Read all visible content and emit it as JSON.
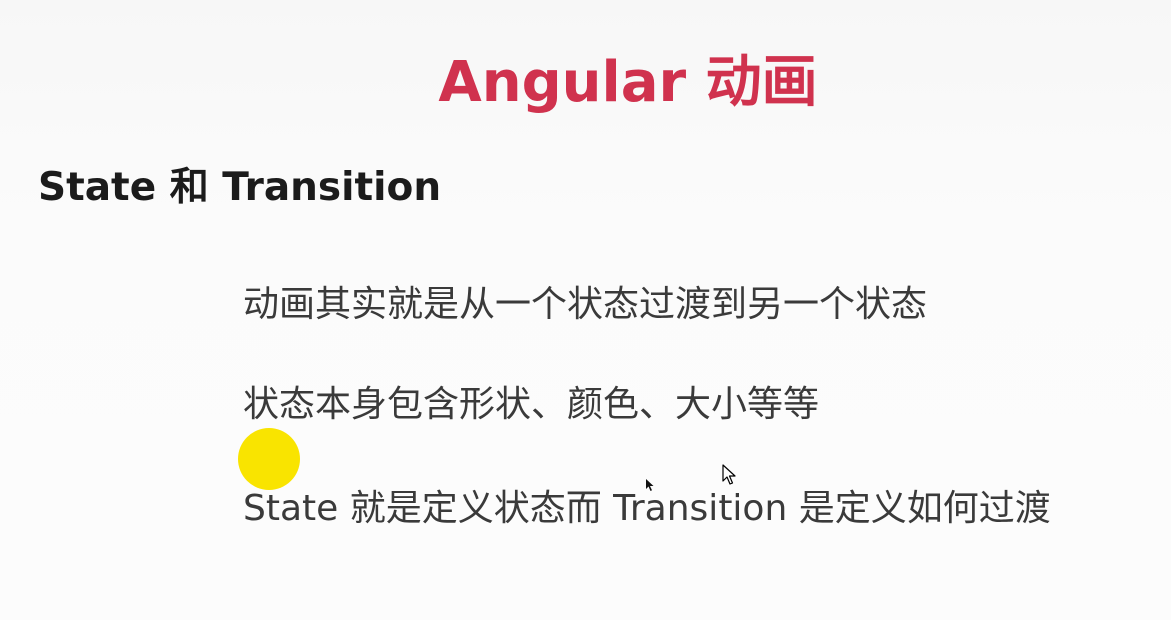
{
  "slide": {
    "title": "Angular 动画",
    "subtitle": "State 和 Transition",
    "bullets": [
      "动画其实就是从一个状态过渡到另一个状态",
      "状态本身包含形状、颜色、大小等等",
      "State 就是定义状态而 Transition 是定义如何过渡"
    ]
  },
  "colors": {
    "title": "#d0324e",
    "subtitle": "#1b1b1b",
    "body_text": "#3a3a3a",
    "laser_pointer": "#f9e400"
  },
  "overlays": {
    "laser_pointer": "yellow-dot",
    "mouse_cursor_icon": "arrow-cursor-icon",
    "secondary_cursor_icon": "small-pointer-icon"
  }
}
